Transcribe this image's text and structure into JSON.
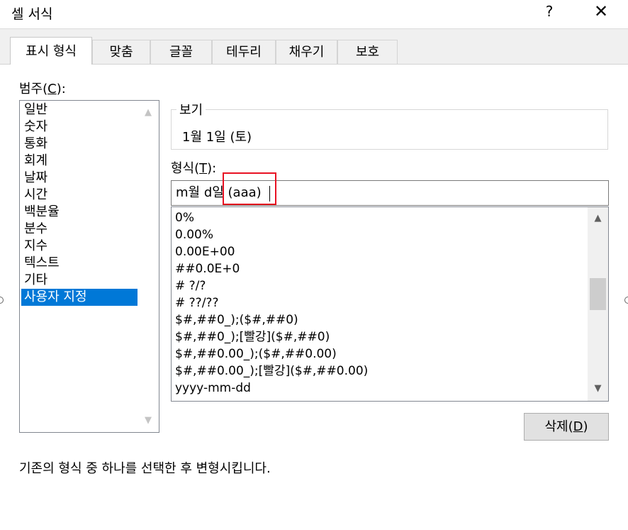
{
  "window": {
    "title": "셀 서식",
    "help": "?",
    "close": "✕"
  },
  "tabs": [
    {
      "label": "표시 형식",
      "active": true
    },
    {
      "label": "맞춤"
    },
    {
      "label": "글꼴"
    },
    {
      "label": "테두리"
    },
    {
      "label": "채우기"
    },
    {
      "label": "보호"
    }
  ],
  "category": {
    "label_prefix": "범주(",
    "label_hotkey": "C",
    "label_suffix": "):",
    "items": [
      "일반",
      "숫자",
      "통화",
      "회계",
      "날짜",
      "시간",
      "백분율",
      "분수",
      "지수",
      "텍스트",
      "기타",
      "사용자 지정"
    ],
    "selected": "사용자 지정"
  },
  "sample": {
    "label": "보기",
    "value": "1월 1일 (토)"
  },
  "format": {
    "label_prefix": "형식(",
    "label_hotkey": "T",
    "label_suffix": "):",
    "value": "m월 d일 (aaa)",
    "list": [
      "0%",
      "0.00%",
      "0.00E+00",
      "##0.0E+0",
      "# ?/?",
      "# ??/??",
      "$#,##0_);($#,##0)",
      "$#,##0_);[빨강]($#,##0)",
      "$#,##0.00_);($#,##0.00)",
      "$#,##0.00_);[빨강]($#,##0.00)",
      "yyyy-mm-dd"
    ]
  },
  "delete_button": {
    "label_prefix": "삭제(",
    "label_hotkey": "D",
    "label_suffix": ")"
  },
  "description": "기존의 형식 중 하나를 선택한 후 변형시킵니다.",
  "colors": {
    "selection": "#0078d7",
    "highlight_box": "#e81123"
  },
  "icons": {
    "up": "chevron-up-icon",
    "down": "chevron-down-icon",
    "close": "close-icon"
  }
}
